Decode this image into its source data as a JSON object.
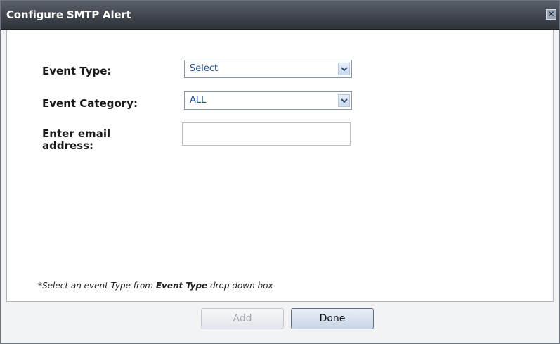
{
  "dialog": {
    "title": "Configure SMTP Alert",
    "close_glyph": "✕"
  },
  "form": {
    "event_type_label": "Event Type:",
    "event_type_value": "Select",
    "event_category_label": "Event Category:",
    "event_category_value": "ALL",
    "email_label_line1": "Enter email",
    "email_label_line2": "address:",
    "email_value": ""
  },
  "footnote": {
    "prefix": "*Select an event Type from ",
    "emphasis": "Event Type",
    "suffix": " drop down box"
  },
  "buttons": {
    "add_label": "Add",
    "add_disabled": true,
    "done_label": "Done"
  },
  "icons": {
    "close": "close-icon",
    "dropdown": "chevron-down-icon"
  },
  "colors": {
    "titlebar": "#41464e",
    "select_text": "#1f4f8f"
  }
}
